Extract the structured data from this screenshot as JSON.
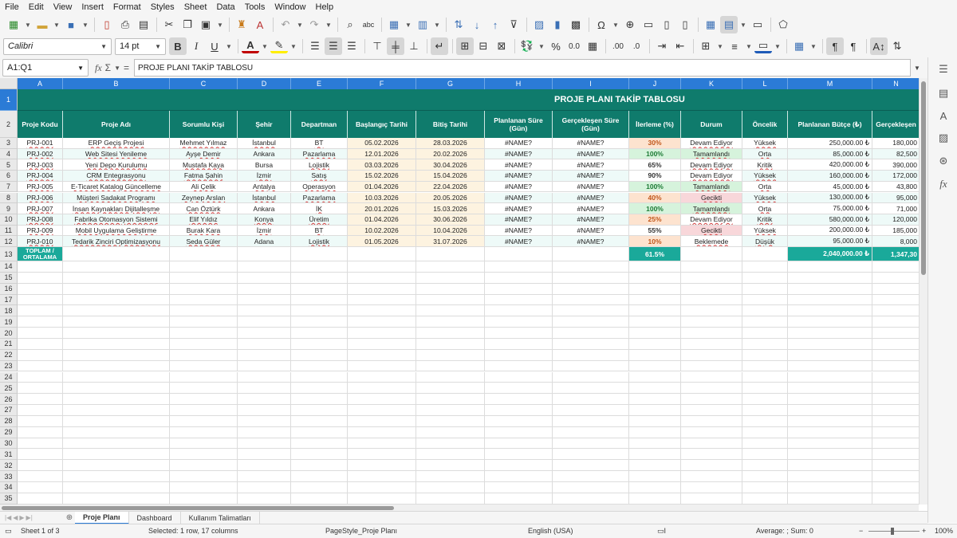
{
  "menu": [
    "File",
    "Edit",
    "View",
    "Insert",
    "Format",
    "Styles",
    "Sheet",
    "Data",
    "Tools",
    "Window",
    "Help"
  ],
  "toolbar": {
    "font_name": "Calibri",
    "font_size": "14 pt",
    "bold_label": "B",
    "italic_label": "I",
    "underline_label": "U",
    "percent_label": "%",
    "decimal_label": "0.0",
    "add_decimal_label": ".00",
    "remove_decimal_label": ".0"
  },
  "formula_bar": {
    "name_box": "A1:Q1",
    "content": "PROJE PLANI TAKİP TABLOSU"
  },
  "columns": [
    "A",
    "B",
    "C",
    "D",
    "E",
    "F",
    "G",
    "H",
    "I",
    "J",
    "K",
    "L",
    "M",
    "N"
  ],
  "row_numbers": [
    "1",
    "2",
    "3",
    "4",
    "5",
    "6",
    "7",
    "8",
    "9",
    "10",
    "11",
    "12",
    "13",
    "14",
    "15",
    "16",
    "17",
    "18",
    "19",
    "20",
    "21",
    "22",
    "23",
    "24",
    "25",
    "26",
    "27",
    "28",
    "29",
    "30",
    "31",
    "32",
    "33",
    "34",
    "35"
  ],
  "sheet": {
    "title": "PROJE PLANI TAKİP TABLOSU",
    "headers": [
      "Proje Kodu",
      "Proje Adı",
      "Sorumlu Kişi",
      "Şehir",
      "Departman",
      "Başlangıç Tarihi",
      "Bitiş Tarihi",
      "Planlanan Süre (Gün)",
      "Gerçekleşen Süre (Gün)",
      "İlerleme (%)",
      "Durum",
      "Öncelik",
      "Planlanan Bütçe (₺)",
      "Gerçekleşen"
    ],
    "rows": [
      [
        "PRJ-001",
        "ERP Geçiş Projesi",
        "Mehmet Yılmaz",
        "İstanbul",
        "BT",
        "05.02.2026",
        "28.03.2026",
        "#NAME?",
        "#NAME?",
        "30%",
        "Devam Ediyor",
        "Yüksek",
        "250,000.00 ₺",
        "180,000"
      ],
      [
        "PRJ-002",
        "Web Sitesi Yenileme",
        "Ayşe Demir",
        "Ankara",
        "Pazarlama",
        "12.01.2026",
        "20.02.2026",
        "#NAME?",
        "#NAME?",
        "100%",
        "Tamamlandı",
        "Orta",
        "85,000.00 ₺",
        "82,500"
      ],
      [
        "PRJ-003",
        "Yeni Depo Kurulumu",
        "Mustafa Kaya",
        "Bursa",
        "Lojistik",
        "03.03.2026",
        "30.04.2026",
        "#NAME?",
        "#NAME?",
        "65%",
        "Devam Ediyor",
        "Kritik",
        "420,000.00 ₺",
        "390,000"
      ],
      [
        "PRJ-004",
        "CRM Entegrasyonu",
        "Fatma Şahin",
        "İzmir",
        "Satış",
        "15.02.2026",
        "15.04.2026",
        "#NAME?",
        "#NAME?",
        "90%",
        "Devam Ediyor",
        "Yüksek",
        "160,000.00 ₺",
        "172,000"
      ],
      [
        "PRJ-005",
        "E-Ticaret Katalog Güncelleme",
        "Ali Çelik",
        "Antalya",
        "Operasyon",
        "01.04.2026",
        "22.04.2026",
        "#NAME?",
        "#NAME?",
        "100%",
        "Tamamlandı",
        "Orta",
        "45,000.00 ₺",
        "43,800"
      ],
      [
        "PRJ-006",
        "Müşteri Sadakat Programı",
        "Zeynep Arslan",
        "İstanbul",
        "Pazarlama",
        "10.03.2026",
        "20.05.2026",
        "#NAME?",
        "#NAME?",
        "40%",
        "Gecikti",
        "Yüksek",
        "130,000.00 ₺",
        "95,000"
      ],
      [
        "PRJ-007",
        "İnsan Kaynakları Dijitalleşme",
        "Can Öztürk",
        "Ankara",
        "İK",
        "20.01.2026",
        "15.03.2026",
        "#NAME?",
        "#NAME?",
        "100%",
        "Tamamlandı",
        "Orta",
        "75,000.00 ₺",
        "71,000"
      ],
      [
        "PRJ-008",
        "Fabrika Otomasyon Sistemi",
        "Elif Yıldız",
        "Konya",
        "Üretim",
        "01.04.2026",
        "30.06.2026",
        "#NAME?",
        "#NAME?",
        "25%",
        "Devam Ediyor",
        "Kritik",
        "580,000.00 ₺",
        "120,000"
      ],
      [
        "PRJ-009",
        "Mobil Uygulama Geliştirme",
        "Burak Kara",
        "İzmir",
        "BT",
        "10.02.2026",
        "10.04.2026",
        "#NAME?",
        "#NAME?",
        "55%",
        "Gecikti",
        "Yüksek",
        "200,000.00 ₺",
        "185,000"
      ],
      [
        "PRJ-010",
        "Tedarik Zinciri Optimizasyonu",
        "Seda Güler",
        "Adana",
        "Lojistik",
        "01.05.2026",
        "31.07.2026",
        "#NAME?",
        "#NAME?",
        "10%",
        "Beklemede",
        "Düşük",
        "95,000.00 ₺",
        "8,000"
      ]
    ],
    "total_row": {
      "label": "TOPLAM / ORTALAMA",
      "progress": "61.5%",
      "planned_budget": "2,040,000.00 ₺",
      "actual_budget": "1,347,30"
    }
  },
  "sheet_tabs": [
    "Proje Planı",
    "Dashboard",
    "Kullanım Talimatları"
  ],
  "status": {
    "sheet": "Sheet 1 of 3",
    "selection": "Selected: 1 row, 17 columns",
    "page_style": "PageStyle_Proje Planı",
    "language": "English (USA)",
    "summary": "Average: ; Sum: 0",
    "zoom": "100%"
  },
  "colors": {
    "header_teal": "#0f7b6c",
    "selection_blue": "#2b7bd6",
    "progress_orange": "#fde3cf",
    "progress_green": "#d6f3dc",
    "status_red": "#f8d7da",
    "total_teal": "#1aa99a"
  },
  "icons": {
    "toolbar_1": [
      "new-doc-icon",
      "open-folder-icon",
      "save-icon",
      "export-pdf-icon",
      "print-icon",
      "print-preview-icon",
      "cut-icon",
      "copy-icon",
      "paste-icon",
      "clone-format-icon",
      "clear-format-icon",
      "undo-icon",
      "redo-icon",
      "find-icon",
      "spellcheck-icon",
      "row-icon",
      "column-icon",
      "sort-icon",
      "sort-asc-icon",
      "sort-desc-icon",
      "autofilter-icon",
      "image-icon",
      "chart-icon",
      "pivot-icon",
      "special-char-icon",
      "hyperlink-icon",
      "comment-icon",
      "header-footer-icon",
      "define-print-icon",
      "freeze-icon",
      "split-icon",
      "show-draw-icon"
    ],
    "sidebar": [
      "menu-icon",
      "properties-icon",
      "styles-icon",
      "gallery-icon",
      "navigator-icon",
      "functions-icon"
    ]
  }
}
